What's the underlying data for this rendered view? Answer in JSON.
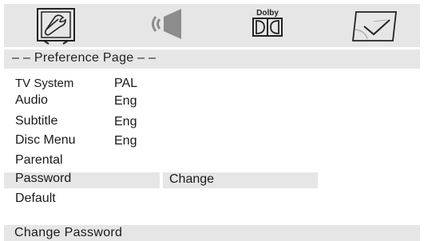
{
  "icons": {
    "general": "general-setup-icon",
    "audio": "speaker-icon",
    "dolby": "dolby-icon",
    "preference": "preference-check-icon",
    "dolby_text": "Dolby"
  },
  "page_title": "– – Preference Page – –",
  "menu": [
    {
      "label": "TV System",
      "value": "PAL"
    },
    {
      "label": "Audio",
      "value": "Eng"
    },
    {
      "label": "Subtitle",
      "value": "Eng"
    },
    {
      "label": "Disc Menu",
      "value": "Eng"
    },
    {
      "label": "Parental",
      "value": ""
    },
    {
      "label": "Password",
      "value": ""
    },
    {
      "label": "Default",
      "value": ""
    }
  ],
  "password_option": "Change",
  "status": "Change Password",
  "colors": {
    "bar_gray": "#e6e6e6",
    "text": "#1a1a1a"
  }
}
